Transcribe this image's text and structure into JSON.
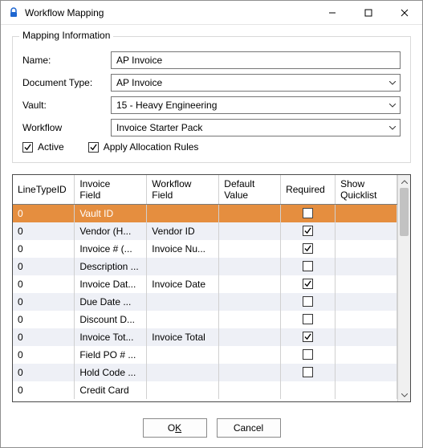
{
  "window": {
    "title": "Workflow Mapping",
    "minimize_name": "minimize-button",
    "maximize_name": "maximize-button",
    "close_name": "close-button"
  },
  "group": {
    "title": "Mapping Information",
    "name_label": "Name:",
    "name_value": "AP Invoice",
    "doc_type_label": "Document Type:",
    "doc_type_value": "AP Invoice",
    "vault_label": "Vault:",
    "vault_value": "15 - Heavy Engineering",
    "workflow_label": "Workflow",
    "workflow_value": "Invoice Starter Pack",
    "active_label": "Active",
    "active_checked": true,
    "apply_alloc_label": "Apply Allocation Rules",
    "apply_alloc_checked": true
  },
  "grid": {
    "columns": [
      {
        "key": "lineTypeId",
        "label": "LineTypeID",
        "width": 70
      },
      {
        "key": "invoiceField",
        "label": "Invoice\nField",
        "width": 82
      },
      {
        "key": "workflowField",
        "label": "Workflow\nField",
        "width": 82
      },
      {
        "key": "defaultValue",
        "label": "Default\nValue",
        "width": 70
      },
      {
        "key": "required",
        "label": "Required",
        "width": 62,
        "center": true
      },
      {
        "key": "showQuicklist",
        "label": "Show\nQuicklist",
        "width": 70,
        "center": true
      }
    ],
    "rows": [
      {
        "lineTypeId": "0",
        "invoiceField": "Vault ID",
        "workflowField": "",
        "defaultValue": "",
        "required": false,
        "showQuicklist": null,
        "selected": true
      },
      {
        "lineTypeId": "0",
        "invoiceField": "Vendor   (H...",
        "workflowField": "Vendor ID",
        "defaultValue": "",
        "required": true,
        "showQuicklist": null
      },
      {
        "lineTypeId": "0",
        "invoiceField": "Invoice #  (...",
        "workflowField": "Invoice Nu...",
        "defaultValue": "",
        "required": true,
        "showQuicklist": null
      },
      {
        "lineTypeId": "0",
        "invoiceField": "Description ...",
        "workflowField": "",
        "defaultValue": "",
        "required": false,
        "showQuicklist": null
      },
      {
        "lineTypeId": "0",
        "invoiceField": "Invoice Dat...",
        "workflowField": "Invoice Date",
        "defaultValue": "",
        "required": true,
        "showQuicklist": null
      },
      {
        "lineTypeId": "0",
        "invoiceField": "Due Date   ...",
        "workflowField": "",
        "defaultValue": "",
        "required": false,
        "showQuicklist": null
      },
      {
        "lineTypeId": "0",
        "invoiceField": "Discount D...",
        "workflowField": "",
        "defaultValue": "",
        "required": false,
        "showQuicklist": null
      },
      {
        "lineTypeId": "0",
        "invoiceField": "Invoice Tot...",
        "workflowField": "Invoice Total",
        "defaultValue": "",
        "required": true,
        "showQuicklist": null
      },
      {
        "lineTypeId": "0",
        "invoiceField": "Field PO # ...",
        "workflowField": "",
        "defaultValue": "",
        "required": false,
        "showQuicklist": null
      },
      {
        "lineTypeId": "0",
        "invoiceField": "Hold Code  ...",
        "workflowField": "",
        "defaultValue": "",
        "required": false,
        "showQuicklist": null
      },
      {
        "lineTypeId": "0",
        "invoiceField": "Credit Card",
        "workflowField": "",
        "defaultValue": "",
        "required": null,
        "showQuicklist": null
      }
    ]
  },
  "buttons": {
    "ok_prefix": "O",
    "ok_key": "K",
    "cancel": "Cancel"
  }
}
